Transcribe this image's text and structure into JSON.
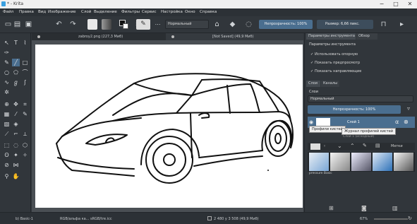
{
  "window": {
    "title": "* - Krita",
    "minimize": "−",
    "maximize": "□",
    "close": "✕"
  },
  "menu": [
    "Файл",
    "Правка",
    "Вид",
    "Изображение",
    "Слой",
    "Выделение",
    "Фильтры",
    "Сервис",
    "Настройка",
    "Окно",
    "Справка"
  ],
  "toolbar": {
    "blend_mode": "Нормальный",
    "opacity_label": "Непрозрачность: 100%",
    "size_label": "Размер: 6,66 пикс."
  },
  "tabs": {
    "doc1": "zabroy2.png (227,3 Миб)",
    "doc2": "[Not Saved]  (49,9 Миб)"
  },
  "docker": {
    "tab_tool_options": "Параметры инструмента",
    "tab_overview": "Обзор",
    "tool_options_title": "Параметры инструмента",
    "options": [
      "Использовать опорную",
      "Показать предпросмотр",
      "Показать направляющие"
    ],
    "tab_layers": "Слои",
    "tab_channels": "Каналы",
    "layers_label": "Слои",
    "layer_blend": "Нормальный",
    "layer_opacity": "Непрозрачность: 100%",
    "layer1_name": "Слой 1",
    "tooltip1": "Профили кистей",
    "tooltip2": "Журнал профилей кистей",
    "background_layer": "Слой 1 (исходный)",
    "presets_filter": "Метки",
    "preset_caption": "pressure Basic"
  },
  "status": {
    "brush": "b) Basic-1",
    "color_space": "RGB/альфа ка... sRGB/tre.icc",
    "dimensions": "2 480 у 3 508 (49,9 Миб)",
    "zoom": "67%"
  },
  "colors": {
    "accent": "#4a6e8f",
    "panel": "#31363b",
    "paper": "#ffffff"
  }
}
